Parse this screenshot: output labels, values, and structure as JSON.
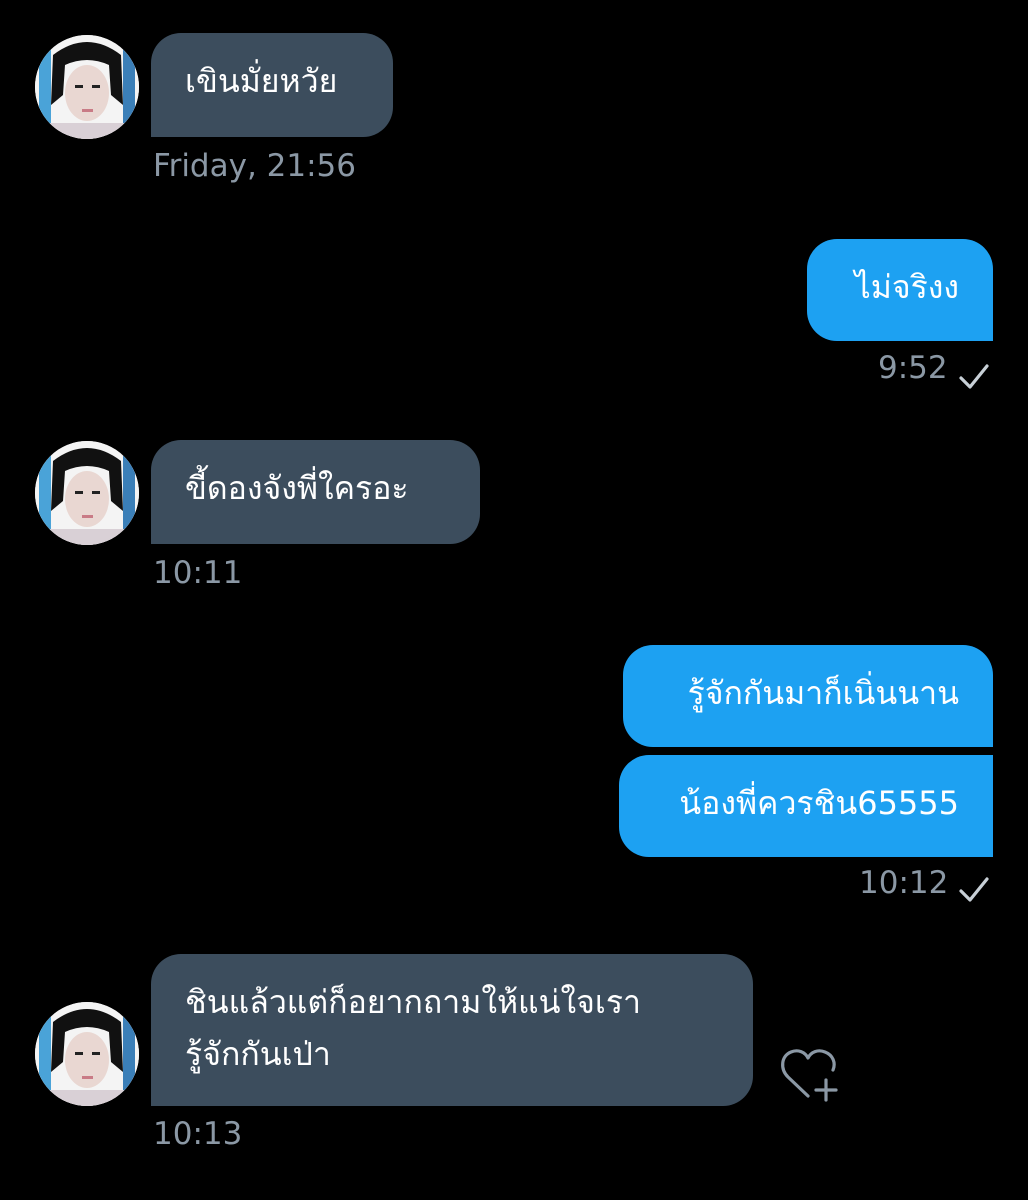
{
  "colors": {
    "background": "#000000",
    "incoming_bubble": "#3c4d5d",
    "outgoing_bubble": "#1da1f2",
    "timestamp": "#8b98a5"
  },
  "messages": [
    {
      "direction": "incoming",
      "text": "เขินมั่ยหวัย",
      "time": "Friday, 21:56"
    },
    {
      "direction": "outgoing",
      "text": "ไม่จริงง",
      "time": "9:52",
      "status": "check-icon"
    },
    {
      "direction": "incoming",
      "text": "ขี้ดองจังพี่ใครอะ",
      "time": "10:11"
    },
    {
      "direction": "outgoing",
      "text": "รู้จักกันมาก็เนิ่นนาน"
    },
    {
      "direction": "outgoing",
      "text": "น้องพี่ควรชิน65555",
      "time": "10:12",
      "status": "check-icon"
    },
    {
      "direction": "incoming",
      "text_line1": "ชินแล้วแต่ก็อยากถามให้แน่ใจเรา",
      "text_line2": "รู้จักกันเป่า",
      "time": "10:13",
      "reaction_button": "heart-plus-icon"
    }
  ]
}
